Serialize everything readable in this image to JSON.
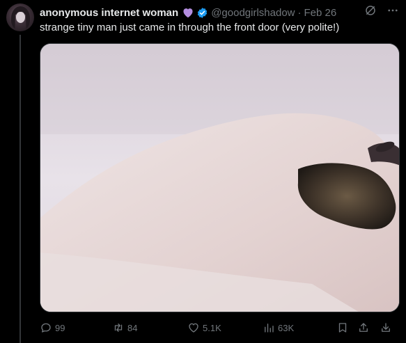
{
  "tweet": {
    "display_name": "anonymous internet woman",
    "handle": "@goodgirlshadow",
    "separator": "·",
    "date": "Feb 26",
    "text": "strange tiny man just came in through the front door (very polite!)"
  },
  "metrics": {
    "replies": "99",
    "reposts": "84",
    "likes": "5.1K",
    "views": "63K"
  },
  "colors": {
    "background": "#000000",
    "text_primary": "#e7e9ea",
    "text_secondary": "#71767b",
    "verified": "#1d9bf0",
    "heart": "#b48ee0"
  },
  "icons": [
    "heart-icon",
    "verified-icon",
    "grok-icon",
    "more-icon",
    "reply-icon",
    "repost-icon",
    "like-icon",
    "views-icon",
    "bookmark-icon",
    "share-icon",
    "download-icon"
  ]
}
